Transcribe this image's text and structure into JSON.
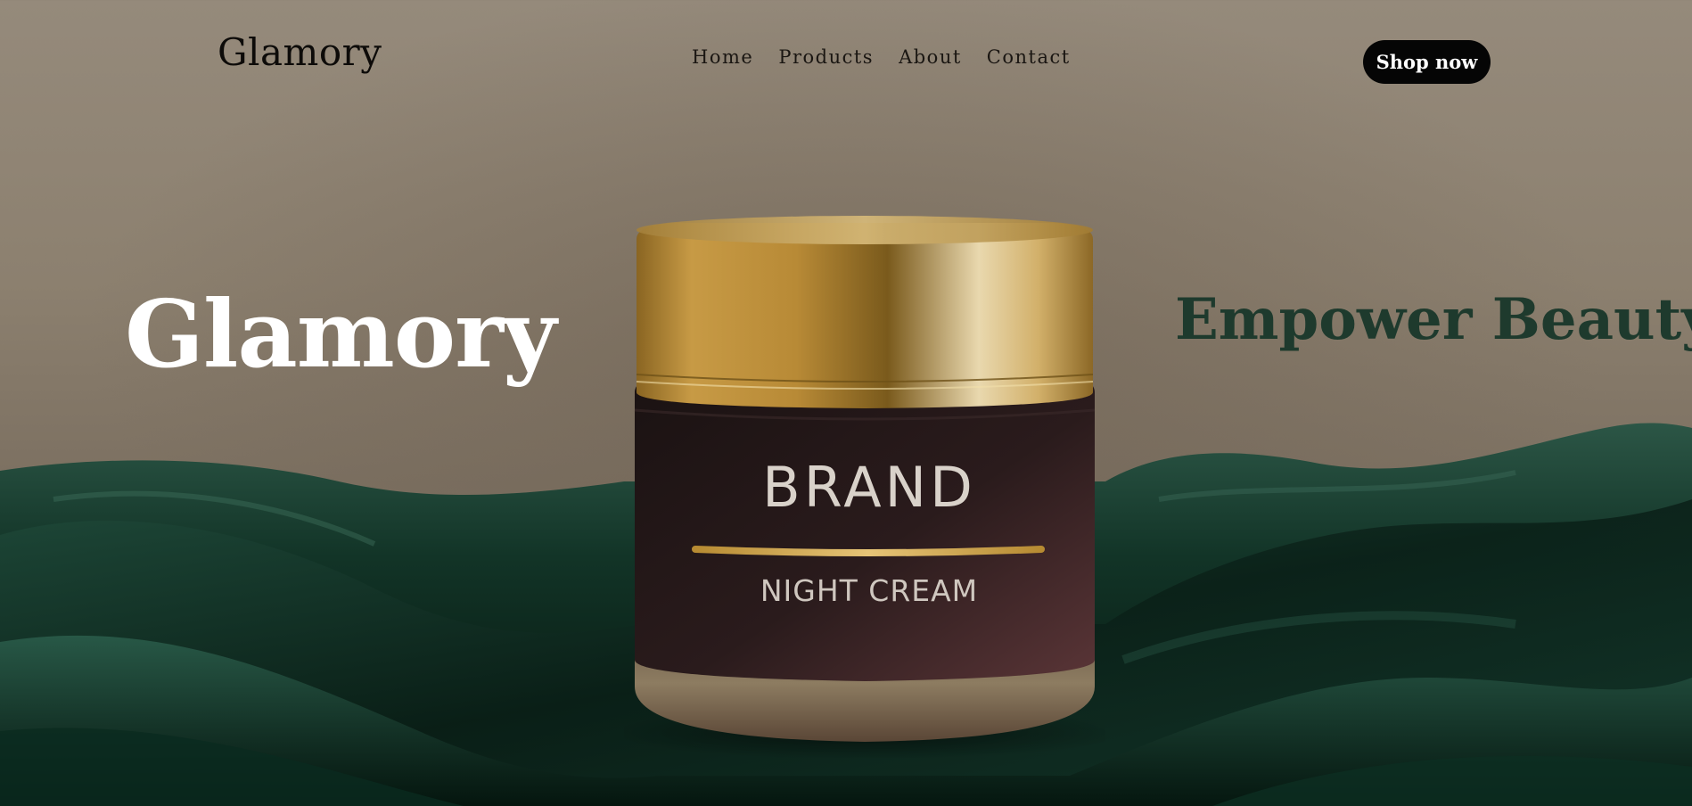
{
  "nav": {
    "logo": "Glamory",
    "links": [
      {
        "label": "Home"
      },
      {
        "label": "Products"
      },
      {
        "label": "About"
      },
      {
        "label": "Contact"
      }
    ],
    "cta_label": "Shop now"
  },
  "hero": {
    "brand": "Glamory",
    "tagline": "Empower Beauty"
  },
  "product": {
    "label_brand": "BRAND",
    "label_name": "NIGHT CREAM"
  },
  "colors": {
    "background": "#8f8373",
    "silk": "#0f3024",
    "gold": "#c9a04a",
    "jar_body": "#2e1c1e",
    "tagline": "#1e3a2d",
    "button": "#050505"
  }
}
